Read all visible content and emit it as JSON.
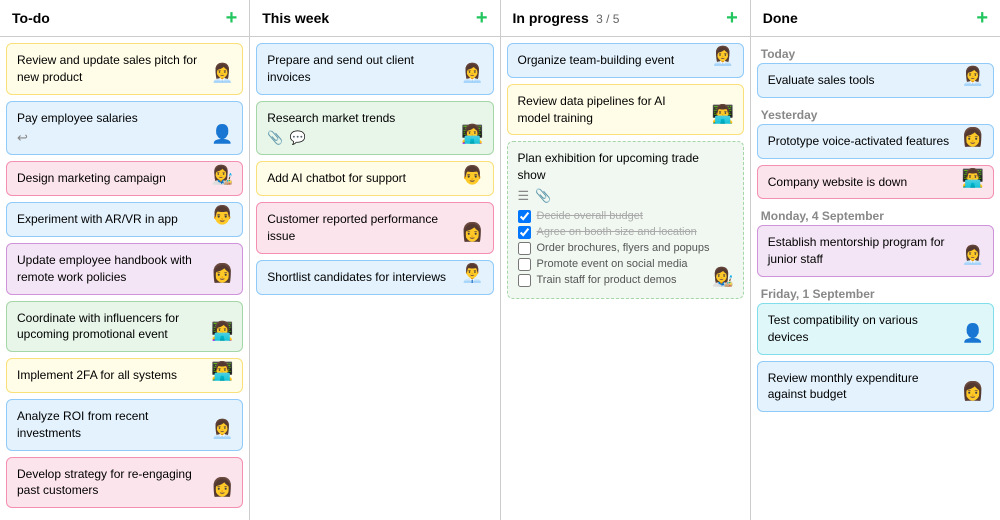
{
  "columns": [
    {
      "id": "todo",
      "title": "To-do",
      "progress": null,
      "cards": [
        {
          "id": "t1",
          "text": "Review and update sales pitch for new product",
          "color": "yellow",
          "avatar": "👩‍💼",
          "icons": []
        },
        {
          "id": "t2",
          "text": "Pay employee salaries",
          "color": "blue",
          "avatar": "👤",
          "icons": [
            "↩"
          ]
        },
        {
          "id": "t3",
          "text": "Design marketing campaign",
          "color": "pink",
          "avatar": "👩‍🎨",
          "icons": []
        },
        {
          "id": "t4",
          "text": "Experiment with AR/VR in app",
          "color": "blue",
          "avatar": "👨",
          "icons": []
        },
        {
          "id": "t5",
          "text": "Update employee handbook with remote work policies",
          "color": "purple",
          "avatar": "👩",
          "icons": []
        },
        {
          "id": "t6",
          "text": "Coordinate with influencers for upcoming promotional event",
          "color": "green",
          "avatar": "👩‍💻",
          "icons": []
        },
        {
          "id": "t7",
          "text": "Implement 2FA for all systems",
          "color": "yellow",
          "avatar": "👨‍💻",
          "icons": []
        },
        {
          "id": "t8",
          "text": "Analyze ROI from recent investments",
          "color": "blue",
          "avatar": "👩‍💼",
          "icons": []
        },
        {
          "id": "t9",
          "text": "Develop strategy for re-engaging past customers",
          "color": "pink",
          "avatar": "👩",
          "icons": []
        }
      ]
    },
    {
      "id": "thisweek",
      "title": "This week",
      "progress": null,
      "cards": [
        {
          "id": "w1",
          "text": "Prepare and send out client invoices",
          "color": "blue",
          "avatar": "👩‍💼",
          "icons": []
        },
        {
          "id": "w2",
          "text": "Research market trends",
          "color": "green",
          "avatar": "👩‍💻",
          "icons": [
            "📎",
            "💬"
          ]
        },
        {
          "id": "w3",
          "text": "Add AI chatbot for support",
          "color": "yellow",
          "avatar": "👨",
          "icons": []
        },
        {
          "id": "w4",
          "text": "Customer reported performance issue",
          "color": "pink",
          "avatar": "👩",
          "icons": []
        },
        {
          "id": "w5",
          "text": "Shortlist candidates for interviews",
          "color": "blue",
          "avatar": "👨‍💼",
          "icons": []
        }
      ]
    },
    {
      "id": "inprogress",
      "title": "In progress",
      "progress": "3 / 5",
      "cards": [
        {
          "id": "p1",
          "text": "Organize team-building event",
          "color": "blue",
          "avatar": "👩‍💼",
          "icons": [],
          "checklist": null
        },
        {
          "id": "p2",
          "text": "Review data pipelines for AI model training",
          "color": "yellow",
          "avatar": "👨‍💻",
          "icons": [],
          "checklist": null
        },
        {
          "id": "p3",
          "text": "Plan exhibition for upcoming trade show",
          "color": "dashed",
          "avatar": "👩‍🎨",
          "icons": [
            "☰",
            "📎"
          ],
          "checklist": [
            {
              "text": "Decide overall budget",
              "checked": true
            },
            {
              "text": "Agree on booth size and location",
              "checked": true
            },
            {
              "text": "Order brochures, flyers and popups",
              "checked": false
            },
            {
              "text": "Promote event on social media",
              "checked": false
            },
            {
              "text": "Train staff for product demos",
              "checked": false
            }
          ]
        }
      ]
    },
    {
      "id": "done",
      "title": "Done",
      "progress": null,
      "sections": [
        {
          "label": "Today",
          "cards": [
            {
              "id": "d1",
              "text": "Evaluate sales tools",
              "color": "blue",
              "avatar": "👩‍💼"
            }
          ]
        },
        {
          "label": "Yesterday",
          "cards": [
            {
              "id": "d2",
              "text": "Prototype voice-activated features",
              "color": "blue",
              "avatar": "👩"
            },
            {
              "id": "d3",
              "text": "Company website is down",
              "color": "pink",
              "avatar": "👨‍💻"
            }
          ]
        },
        {
          "label": "Monday, 4 September",
          "cards": [
            {
              "id": "d4",
              "text": "Establish mentorship program for junior staff",
              "color": "purple",
              "avatar": "👩‍💼"
            }
          ]
        },
        {
          "label": "Friday, 1 September",
          "cards": [
            {
              "id": "d5",
              "text": "Test compatibility on various devices",
              "color": "teal",
              "avatar": "👤"
            },
            {
              "id": "d6",
              "text": "Review monthly expenditure against budget",
              "color": "blue",
              "avatar": "👩"
            }
          ]
        }
      ]
    }
  ],
  "add_button_label": "+",
  "avatar_map": {
    "👩‍💼": "👩‍💼",
    "👤": "👤",
    "👩‍🎨": "👩‍🎨",
    "👨": "👨",
    "👩": "👩",
    "👩‍💻": "👩‍💻",
    "👨‍💻": "👨‍💻",
    "👨‍💼": "👨‍💼"
  }
}
